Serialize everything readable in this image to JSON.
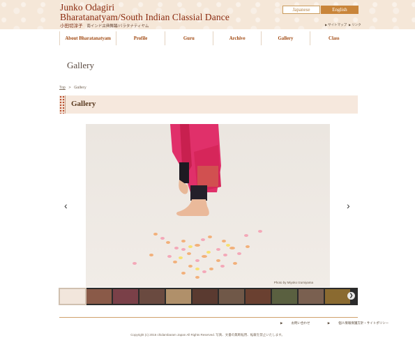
{
  "header": {
    "title_line1": "Junko Odagiri",
    "title_line2": "Bharatanatyam/South Indian Classial Dance",
    "subtitle_name": "小田切淳子",
    "subtitle_desc": "南インド古典舞踊/バラタナティヤム",
    "lang_japanese": "Japanese",
    "lang_english": "English",
    "util_sitemap": "サイトマップ",
    "util_links": "リンク"
  },
  "nav": [
    {
      "label": "About Bharatanatyam"
    },
    {
      "label": "Profile"
    },
    {
      "label": "Guru"
    },
    {
      "label": "Archive"
    },
    {
      "label": "Gallery"
    },
    {
      "label": "Class"
    }
  ],
  "page": {
    "heading": "Gallery",
    "breadcrumb_top": "Top",
    "breadcrumb_sep": ">",
    "breadcrumb_current": "Gallery",
    "section_title": "Gallery"
  },
  "gallery": {
    "credit": "Photo by Miyoko Izumiyama",
    "prev_icon": "chevron-left-icon",
    "next_icon": "chevron-right-icon",
    "thumb_count": 11
  },
  "footer": {
    "contact": "お問い合わせ",
    "privacy": "個人情報保護方針・サイトポリシー",
    "copyright": "Copyright (c) 2016 chidambaram Japan All Rights Reserved. 写真、文書の無断転用、転載を禁止いたします。"
  }
}
